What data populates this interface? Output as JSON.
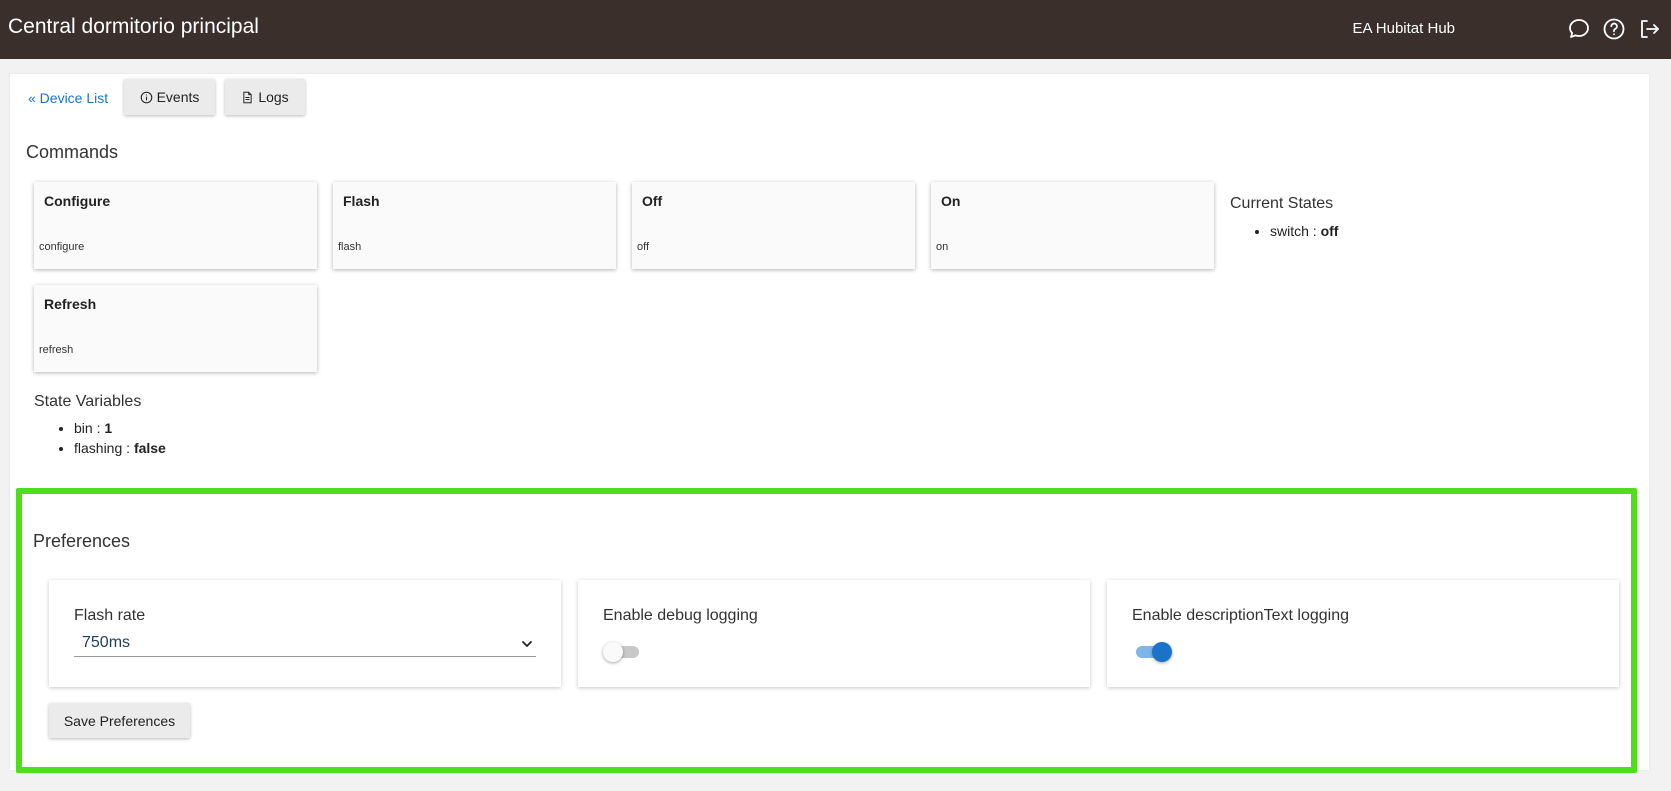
{
  "header": {
    "title": "Central dormitorio principal",
    "hub_name": "EA Hubitat Hub",
    "icons": [
      "chat-icon",
      "help-icon",
      "logout-icon"
    ]
  },
  "nav": {
    "device_list_link": "« Device List",
    "events_label": "Events",
    "logs_label": "Logs"
  },
  "commands": {
    "title": "Commands",
    "items": [
      {
        "name": "Configure",
        "id": "configure"
      },
      {
        "name": "Flash",
        "id": "flash"
      },
      {
        "name": "Off",
        "id": "off"
      },
      {
        "name": "On",
        "id": "on"
      },
      {
        "name": "Refresh",
        "id": "refresh"
      }
    ]
  },
  "current_states": {
    "title": "Current States",
    "items": [
      {
        "key": "switch : ",
        "value": "off"
      }
    ]
  },
  "state_variables": {
    "title": "State Variables",
    "items": [
      {
        "key": "bin : ",
        "value": "1"
      },
      {
        "key": "flashing : ",
        "value": "false"
      }
    ]
  },
  "preferences": {
    "title": "Preferences",
    "flash_rate": {
      "label": "Flash rate",
      "value": "750ms"
    },
    "debug_logging": {
      "label": "Enable debug logging",
      "enabled": false
    },
    "desc_text_logging": {
      "label": "Enable descriptionText logging",
      "enabled": true
    },
    "save_label": "Save Preferences",
    "highlight_color": "#4de01a"
  },
  "colors": {
    "header_bg": "#3b2f2c",
    "link": "#1a73c8",
    "toggle_on": "#1a73c8"
  }
}
